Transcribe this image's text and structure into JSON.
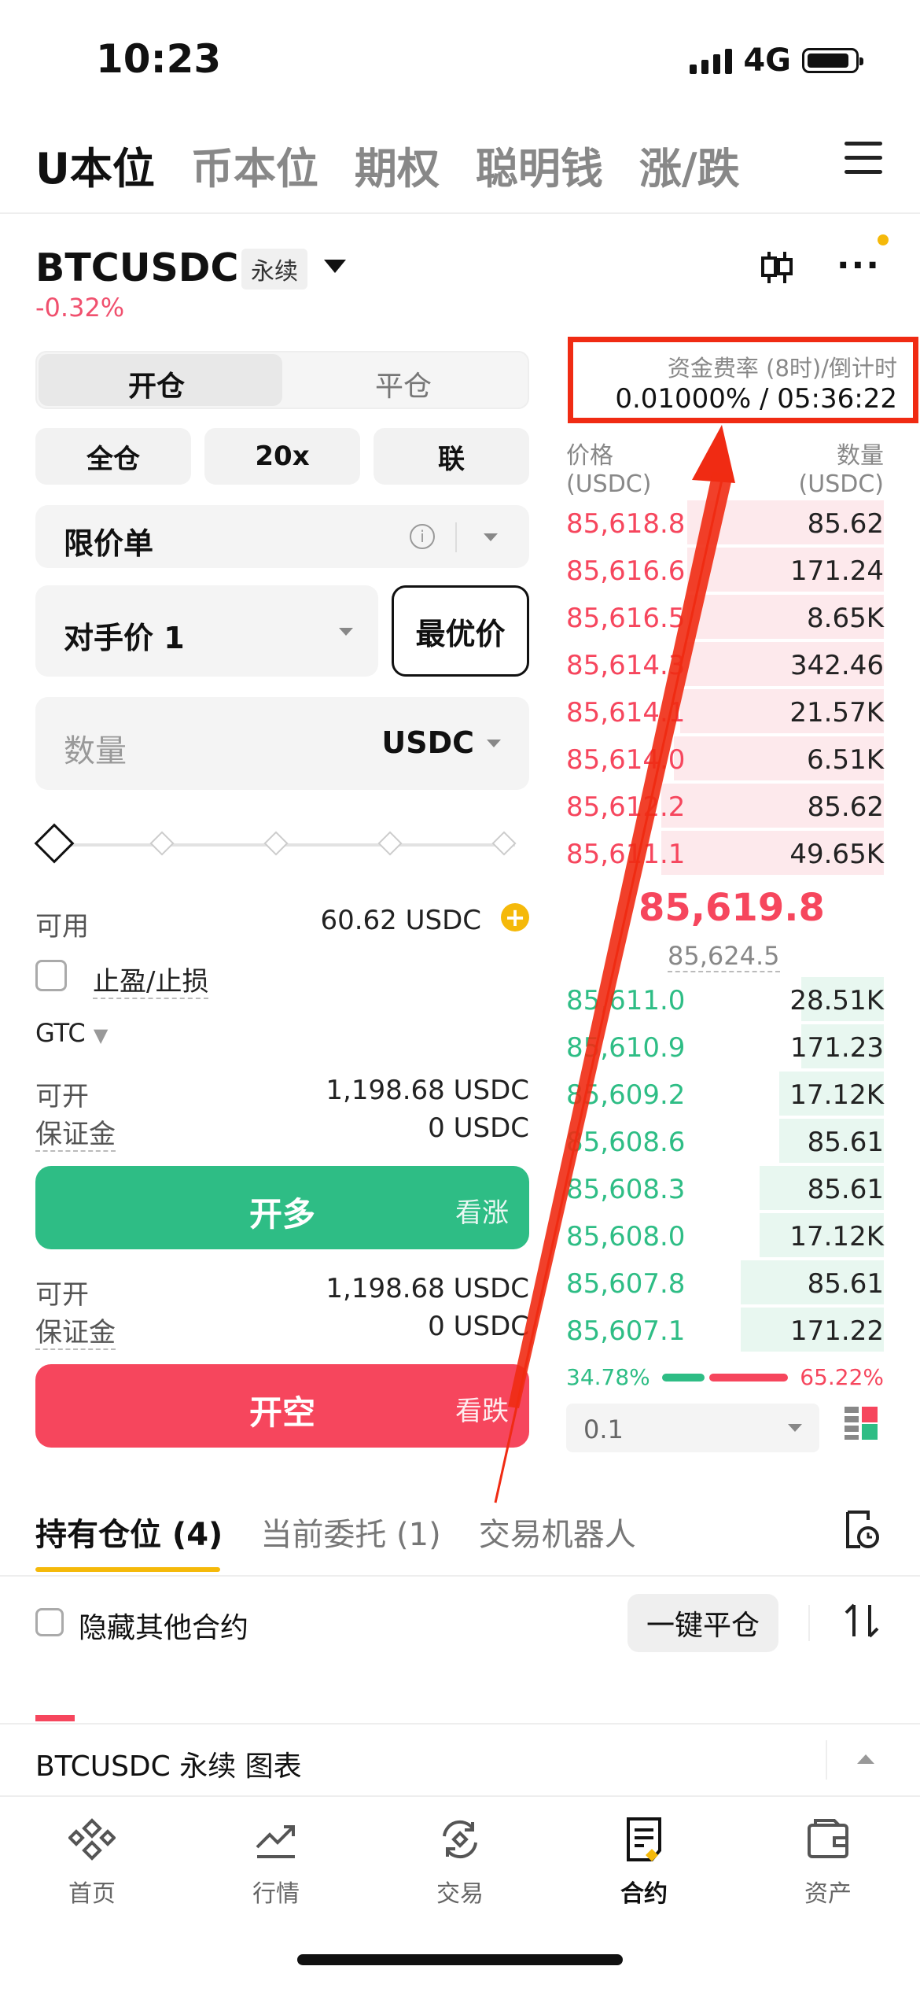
{
  "status_bar": {
    "time": "10:23",
    "network": "4G"
  },
  "top_tabs": [
    {
      "label": "U本位",
      "active": true
    },
    {
      "label": "币本位",
      "active": false
    },
    {
      "label": "期权",
      "active": false
    },
    {
      "label": "聪明钱",
      "active": false
    },
    {
      "label": "涨/跌",
      "active": false
    }
  ],
  "symbol": {
    "name": "BTCUSDC",
    "type": "永续",
    "change": "-0.32%"
  },
  "trade": {
    "open_tab": "开仓",
    "close_tab": "平仓",
    "margin_mode": "全仓",
    "leverage": "20x",
    "mode_link": "联",
    "order_type": "限价单",
    "price_option": "对手价 1",
    "best_price": "最优价",
    "qty_placeholder": "数量",
    "qty_unit": "USDC",
    "available_label": "可用",
    "available_value": "60.62 USDC",
    "tpsl_label": "止盈/止损",
    "tif": "GTC",
    "long": {
      "max_label": "可开",
      "max_value": "1,198.68 USDC",
      "margin_label": "保证金",
      "margin_value": "0 USDC",
      "button": "开多",
      "sub": "看涨"
    },
    "short": {
      "max_label": "可开",
      "max_value": "1,198.68 USDC",
      "margin_label": "保证金",
      "margin_value": "0 USDC",
      "button": "开空",
      "sub": "看跌"
    }
  },
  "funding": {
    "label": "资金费率 (8时)/倒计时",
    "value": "0.01000% / 05:36:22"
  },
  "orderbook": {
    "price_header": "价格",
    "price_unit": "(USDC)",
    "qty_header": "数量",
    "qty_unit": "(USDC)",
    "asks": [
      {
        "price": "85,618.8",
        "qty": "85.62",
        "depth": 0.62
      },
      {
        "price": "85,616.6",
        "qty": "171.24",
        "depth": 0.62
      },
      {
        "price": "85,616.5",
        "qty": "8.65K",
        "depth": 0.62
      },
      {
        "price": "85,614.3",
        "qty": "342.46",
        "depth": 0.63
      },
      {
        "price": "85,614.1",
        "qty": "21.57K",
        "depth": 0.64
      },
      {
        "price": "85,614.0",
        "qty": "6.51K",
        "depth": 0.66
      },
      {
        "price": "85,612.2",
        "qty": "85.62",
        "depth": 0.7
      },
      {
        "price": "85,611.1",
        "qty": "49.65K",
        "depth": 0.7
      }
    ],
    "last_price": "85,619.8",
    "mark_price": "85,624.5",
    "bids": [
      {
        "price": "85,611.0",
        "qty": "28.51K",
        "depth": 0.26
      },
      {
        "price": "85,610.9",
        "qty": "171.23",
        "depth": 0.26
      },
      {
        "price": "85,609.2",
        "qty": "17.12K",
        "depth": 0.33
      },
      {
        "price": "85,608.6",
        "qty": "85.61",
        "depth": 0.33
      },
      {
        "price": "85,608.3",
        "qty": "85.61",
        "depth": 0.39
      },
      {
        "price": "85,608.0",
        "qty": "17.12K",
        "depth": 0.39
      },
      {
        "price": "85,607.8",
        "qty": "85.61",
        "depth": 0.45
      },
      {
        "price": "85,607.1",
        "qty": "171.22",
        "depth": 0.45
      }
    ],
    "buy_ratio": "34.78%",
    "sell_ratio": "65.22%",
    "depth_step": "0.1"
  },
  "positions": {
    "tabs": [
      {
        "label": "持有仓位 (4)",
        "active": true
      },
      {
        "label": "当前委托 (1)",
        "active": false
      },
      {
        "label": "交易机器人",
        "active": false
      }
    ],
    "hide_others": "隐藏其他合约",
    "close_all": "一键平仓"
  },
  "chart_bar": {
    "label": "BTCUSDC 永续 图表"
  },
  "nav": [
    {
      "label": "首页",
      "icon": "home-icon",
      "active": false
    },
    {
      "label": "行情",
      "icon": "markets-icon",
      "active": false
    },
    {
      "label": "交易",
      "icon": "trade-icon",
      "active": false
    },
    {
      "label": "合约",
      "icon": "futures-icon",
      "active": true
    },
    {
      "label": "资产",
      "icon": "assets-icon",
      "active": false
    }
  ],
  "colors": {
    "green": "#2ebd85",
    "red": "#f6465d",
    "accent": "#f5b90a",
    "annotation": "#f02b13"
  }
}
